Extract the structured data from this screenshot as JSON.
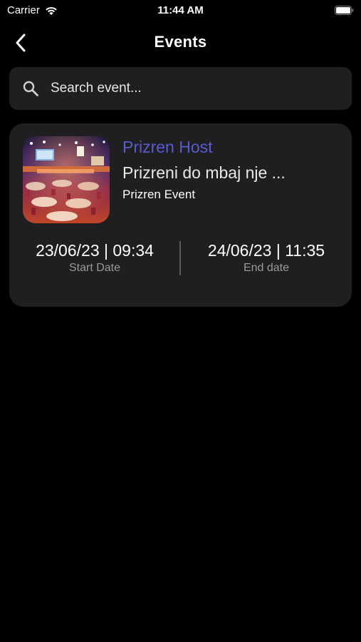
{
  "status_bar": {
    "carrier": "Carrier",
    "time": "11:44 AM"
  },
  "nav": {
    "title": "Events",
    "back_icon": "chevron-left-icon"
  },
  "search": {
    "placeholder": "Search event...",
    "value": "",
    "icon": "search-icon"
  },
  "events": [
    {
      "host": "Prizren Host",
      "title": "Prizreni do mbaj nje ...",
      "category": "Prizren Event",
      "start_date": "23/06/23 | 09:34",
      "start_label": "Start Date",
      "end_date": "24/06/23 | 11:35",
      "end_label": "End date"
    }
  ],
  "colors": {
    "background": "#000000",
    "card": "#1f1f21",
    "accent": "#5a5bd0",
    "muted_text": "#9a9a9a"
  }
}
